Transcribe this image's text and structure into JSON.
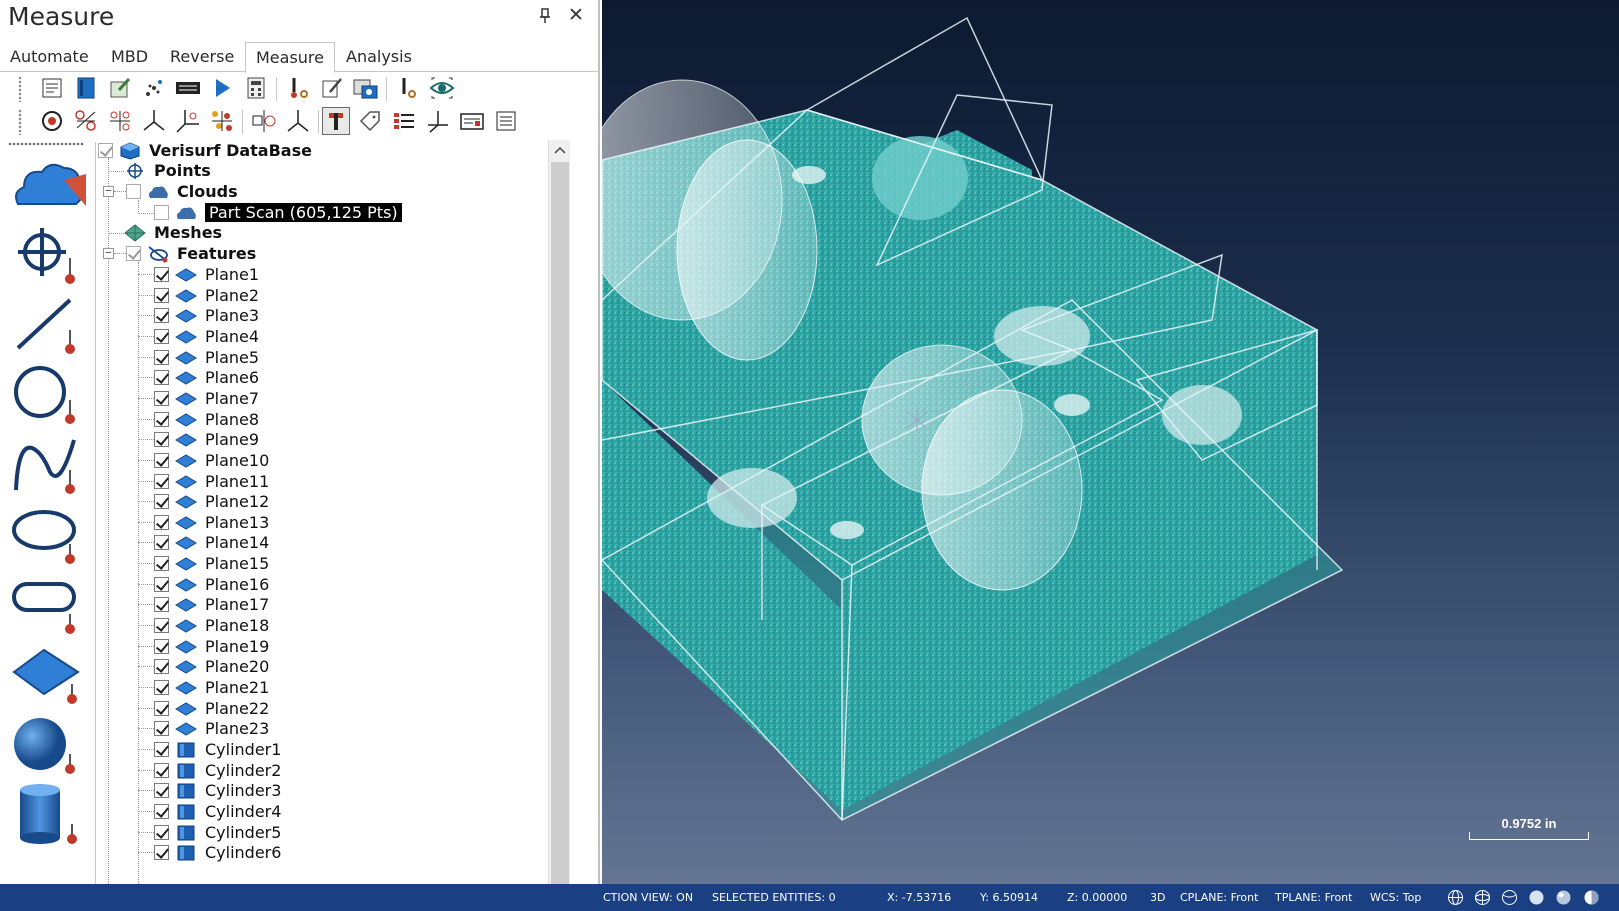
{
  "panel": {
    "title": "Measure",
    "pin_symbol": "⊥",
    "close_symbol": "✕"
  },
  "ribbon_tabs": [
    {
      "label": "Automate",
      "active": false
    },
    {
      "label": "MBD",
      "active": false
    },
    {
      "label": "Reverse",
      "active": false
    },
    {
      "label": "Measure",
      "active": true
    },
    {
      "label": "Analysis",
      "active": false
    }
  ],
  "toolbar_row1_icons": [
    "properties-icon",
    "book-icon",
    "edit-image-icon",
    "sparkle-points-icon",
    "display-bar-icon",
    "play-icon",
    "calculator-icon",
    "probe-settings-icon",
    "pen-edit-icon",
    "camera-icon",
    "probe-tool-icon",
    "eye-view-icon"
  ],
  "toolbar_row2_icons": [
    "target-icon",
    "constructs-icon",
    "points-network-icon",
    "axes-icon",
    "axes-alt-icon",
    "scatter-icon",
    "mirror-icon",
    "axes-small-icon",
    "anchor-icon",
    "tag-icon",
    "list-icon",
    "coordinate-icon",
    "report-icon",
    "notes-icon"
  ],
  "left_toolbar_icons": [
    "cloud-measure-icon",
    "point-measure-icon",
    "line-measure-icon",
    "circle-measure-icon",
    "spline-measure-icon",
    "ellipse-measure-icon",
    "slot-measure-icon",
    "plane-measure-icon",
    "sphere-measure-icon",
    "cylinder-measure-icon"
  ],
  "tree": {
    "root": "Verisurf DataBase",
    "points": "Points",
    "clouds": "Clouds",
    "part_scan": "Part Scan (605,125 Pts)",
    "meshes": "Meshes",
    "features": "Features",
    "planes": [
      "Plane1",
      "Plane2",
      "Plane3",
      "Plane4",
      "Plane5",
      "Plane6",
      "Plane7",
      "Plane8",
      "Plane9",
      "Plane10",
      "Plane11",
      "Plane12",
      "Plane13",
      "Plane14",
      "Plane15",
      "Plane16",
      "Plane17",
      "Plane18",
      "Plane19",
      "Plane20",
      "Plane21",
      "Plane22",
      "Plane23"
    ],
    "cylinders": [
      "Cylinder1",
      "Cylinder2",
      "Cylinder3",
      "Cylinder4",
      "Cylinder5",
      "Cylinder6"
    ]
  },
  "viewport": {
    "scale_label": "0.9752 in"
  },
  "status_bar": {
    "selection_view": "CTION VIEW: ON",
    "selected_entities": "SELECTED ENTITIES: 0",
    "x": "X:  -7.53716",
    "y": "Y:  6.50914",
    "z": "Z:  0.00000",
    "mode": "3D",
    "cplane": "CPLANE: Front",
    "tplane": "TPLANE: Front",
    "wcs": "WCS: Top"
  },
  "colors": {
    "status_bar": "#1a3f82",
    "scan_teal": "#2aa3a3",
    "plane_icon": "#2f7fd6"
  }
}
